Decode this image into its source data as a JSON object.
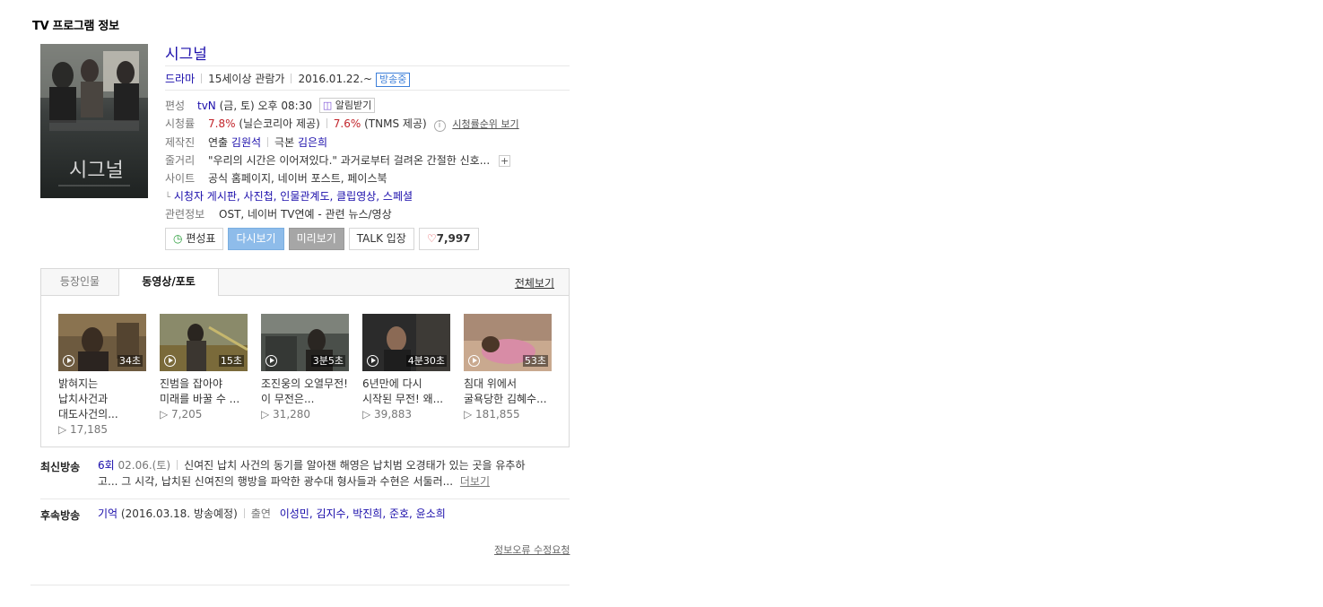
{
  "section_title": "TV 프로그램 정보",
  "program": {
    "title": "시그널",
    "genre": "드라마",
    "rating": "15세이상 관람가",
    "start_date": "2016.01.22.~",
    "status_badge": "방송중",
    "poster_text": "시그널"
  },
  "info_rows": {
    "schedule": {
      "label": "편성",
      "channel": "tvN",
      "time": "(금, 토) 오후 08:30",
      "alarm_button": "알림받기"
    },
    "viewership": {
      "label": "시청률",
      "nielsen_value": "7.8%",
      "nielsen_src": "(닐슨코리아 제공)",
      "tnms_value": "7.6%",
      "tnms_src": "(TNMS 제공)",
      "rank_link": "시청률순위 보기"
    },
    "staff": {
      "label": "제작진",
      "director_role": "연출",
      "director": "김원석",
      "writer_role": "극본",
      "writer": "김은희"
    },
    "synopsis": {
      "label": "줄거리",
      "text": "\"우리의 시간은 이어져있다.\" 과거로부터 걸려온 간절한 신호..."
    },
    "site": {
      "label": "사이트",
      "links": "공식 홈페이지, 네이버 포스트, 페이스북"
    },
    "site_sub": {
      "links": "시청자 게시판, 사진첩, 인물관계도, 클립영상, 스페셜"
    },
    "related": {
      "label": "관련정보",
      "links": "OST, 네이버 TV연예 - 관련 뉴스/영상"
    }
  },
  "buttons": {
    "schedule_table": "편성표",
    "replay": "다시보기",
    "preview": "미리보기",
    "talk": "TALK 입장",
    "likes": "7,997"
  },
  "tabs": {
    "characters": "등장인물",
    "videos": "동영상/포토",
    "view_all": "전체보기"
  },
  "videos": [
    {
      "duration": "34초",
      "title": "밝혀지는 납치사건과 대도사건의...",
      "views": "▷ 17,185"
    },
    {
      "duration": "15초",
      "title": "진범을 잡아야 미래를 바꿀 수 ...",
      "views": "▷ 7,205"
    },
    {
      "duration": "3분5초",
      "title": "조진웅의 오열무전! 이 무전은...",
      "views": "▷ 31,280"
    },
    {
      "duration": "4분30초",
      "title": "6년만에 다시 시작된 무전! 왜...",
      "views": "▷ 39,883"
    },
    {
      "duration": "53초",
      "title": "침대 위에서 굴욕당한 김혜수...",
      "views": "▷ 181,855"
    }
  ],
  "latest": {
    "label": "최신방송",
    "episode": "6회",
    "date": "02.06.(토)",
    "text1": "신여진 납치 사건의 동기를 알아챈 해영은 납치범 오경태가 있는 곳을 유추하",
    "text2": "고... 그 시각, 납치된 신여진의 행방을 파악한 광수대 형사들과 수현은 서둘러...",
    "more": "더보기"
  },
  "next": {
    "label": "후속방송",
    "title": "기억",
    "date": "(2016.03.18. 방송예정)",
    "cast_label": "출연",
    "cast": "이성민, 김지수, 박진희, 준호, 윤소희"
  },
  "report_link": "정보오류 수정요청",
  "colors": {
    "link": "#1a0dab",
    "rating_red": "#c2242b",
    "badge_blue": "#3d7fd9",
    "replay_btn": "#8ebcea",
    "preview_btn": "#a6a6a6"
  }
}
